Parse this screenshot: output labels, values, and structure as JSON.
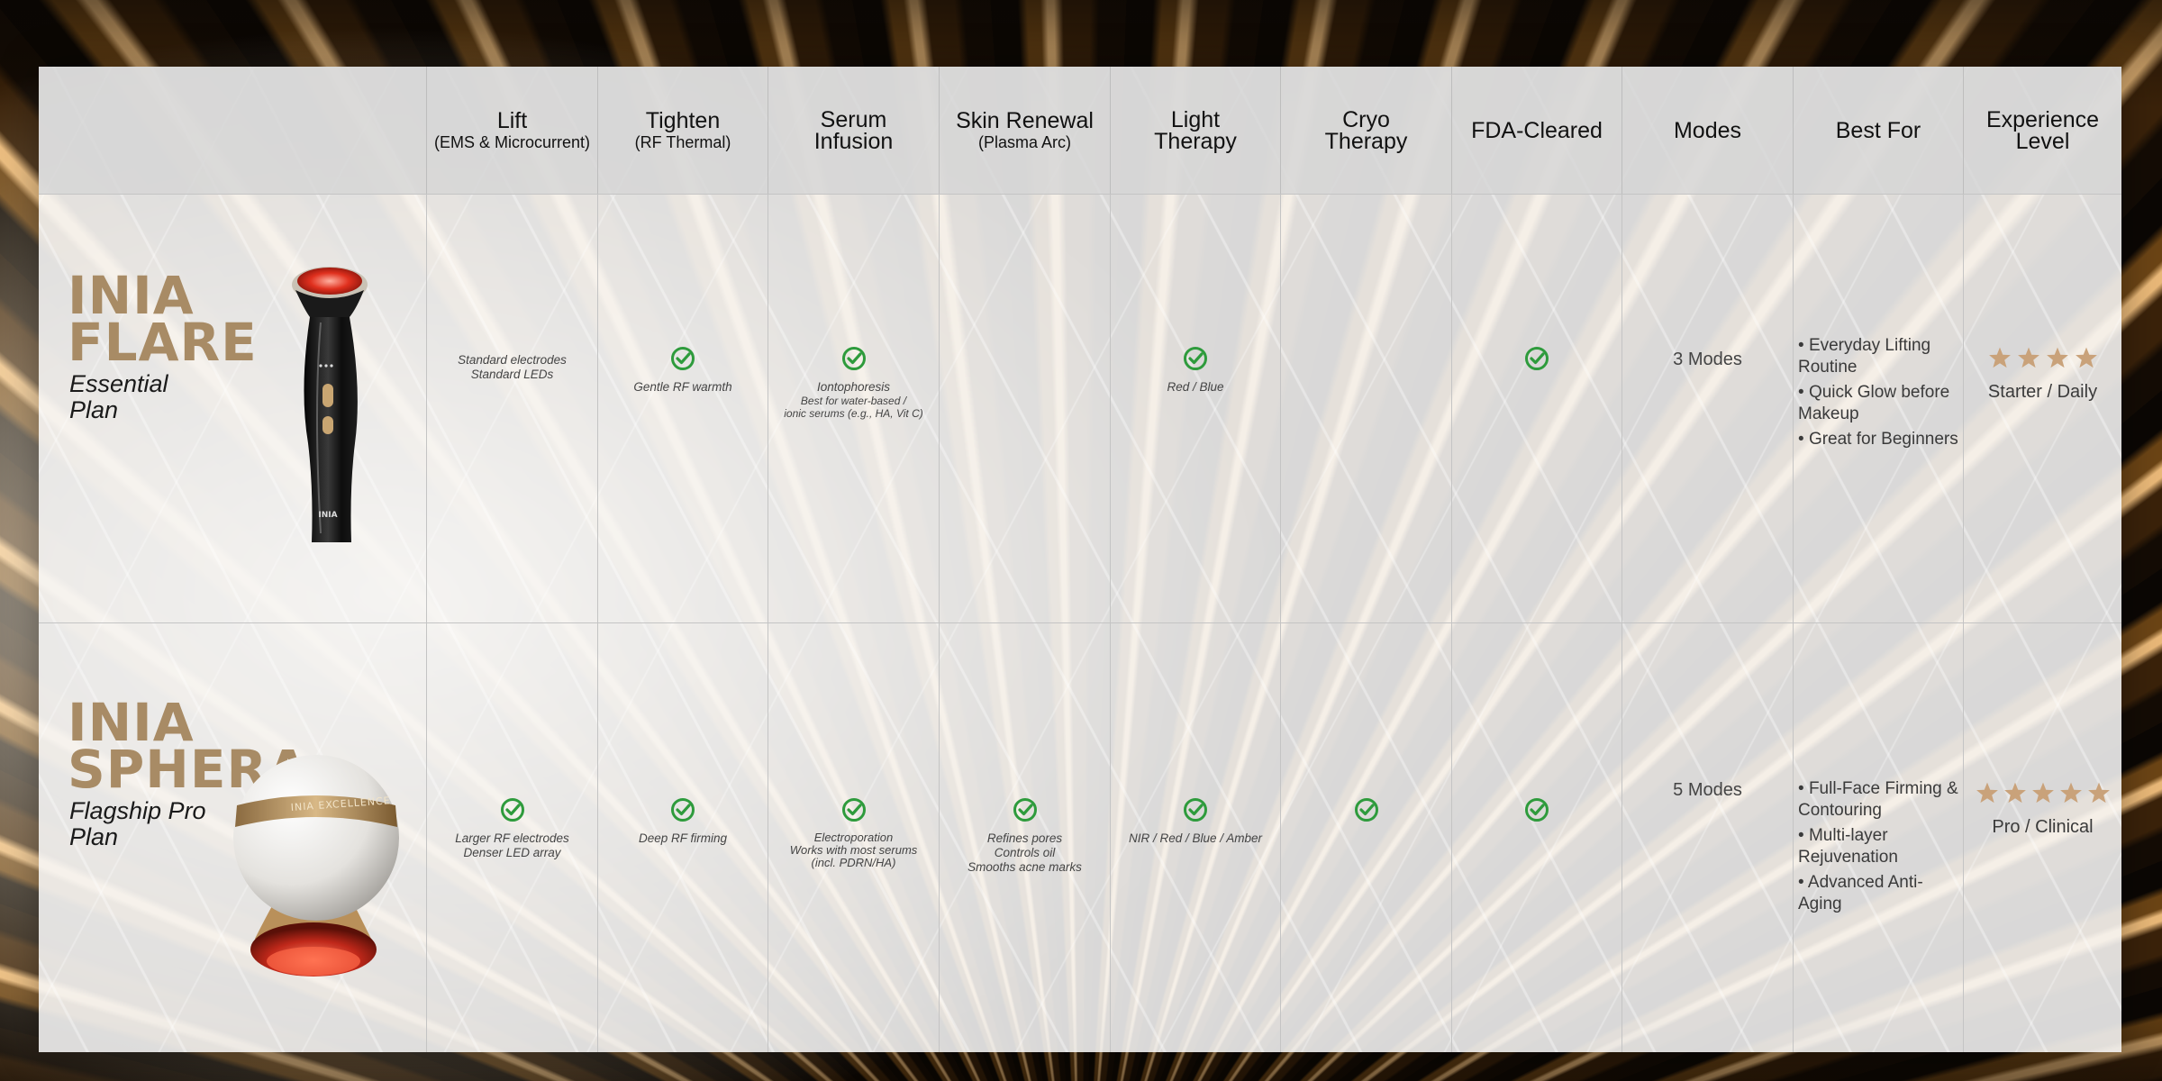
{
  "colors": {
    "check": "#2e9b3c",
    "star": "#c9a27a",
    "brand_gold": "#a88b65",
    "header_bg": "#d6d6d6"
  },
  "header": {
    "columns": [
      {
        "main": "Lift",
        "sub": "(EMS & Microcurrent)"
      },
      {
        "main": "Tighten",
        "sub": "(RF Thermal)"
      },
      {
        "main": "Serum\nInfusion",
        "sub": ""
      },
      {
        "main": "Skin Renewal",
        "sub": "(Plasma Arc)"
      },
      {
        "main": "Light\nTherapy",
        "sub": ""
      },
      {
        "main": "Cryo\nTherapy",
        "sub": ""
      },
      {
        "main": "FDA-Cleared",
        "sub": ""
      },
      {
        "main": "Modes",
        "sub": ""
      },
      {
        "main": "Best For",
        "sub": ""
      },
      {
        "main": "Experience\nLevel",
        "sub": ""
      }
    ]
  },
  "rows": [
    {
      "brand": "INIA\nFLARE",
      "plan": "Essential\nPlan",
      "device_icon": "handheld-wand-device",
      "lift": {
        "check": false,
        "note": "Standard electrodes\nStandard LEDs"
      },
      "tighten": {
        "check": true,
        "note": "Gentle RF warmth"
      },
      "serum": {
        "check": true,
        "note": "Iontophoresis",
        "note_small": "Best for water-based /\nionic serums   (e.g., HA, Vit C)"
      },
      "renewal": {
        "check": false,
        "note": ""
      },
      "light": {
        "check": true,
        "note": "Red / Blue"
      },
      "cryo": {
        "check": false,
        "note": ""
      },
      "fda": {
        "check": true
      },
      "modes": "3 Modes",
      "best_for": [
        "Everyday Lifting Routine",
        "Quick Glow before Makeup",
        "Great for Beginners"
      ],
      "stars": 4,
      "level": "Starter / Daily"
    },
    {
      "brand": "INIA\nSPHERA",
      "plan": "Flagship Pro\nPlan",
      "device_icon": "sphere-device",
      "device_band_text": "INIA EXCELLENCE",
      "lift": {
        "check": true,
        "note": "Larger RF electrodes\nDenser LED array"
      },
      "tighten": {
        "check": true,
        "note": "Deep RF firming"
      },
      "serum": {
        "check": true,
        "note": "Electroporation\nWorks with most serums\n(incl. PDRN/HA)"
      },
      "renewal": {
        "check": true,
        "note": "Refines pores\nControls oil\nSmooths acne marks"
      },
      "light": {
        "check": true,
        "note": "NIR / Red / Blue / Amber"
      },
      "cryo": {
        "check": true,
        "note": ""
      },
      "fda": {
        "check": true
      },
      "modes": "5 Modes",
      "best_for": [
        "Full-Face Firming & Contouring",
        "Multi-layer Rejuvenation",
        "Advanced Anti-Aging"
      ],
      "stars": 5,
      "level": "Pro / Clinical"
    }
  ]
}
